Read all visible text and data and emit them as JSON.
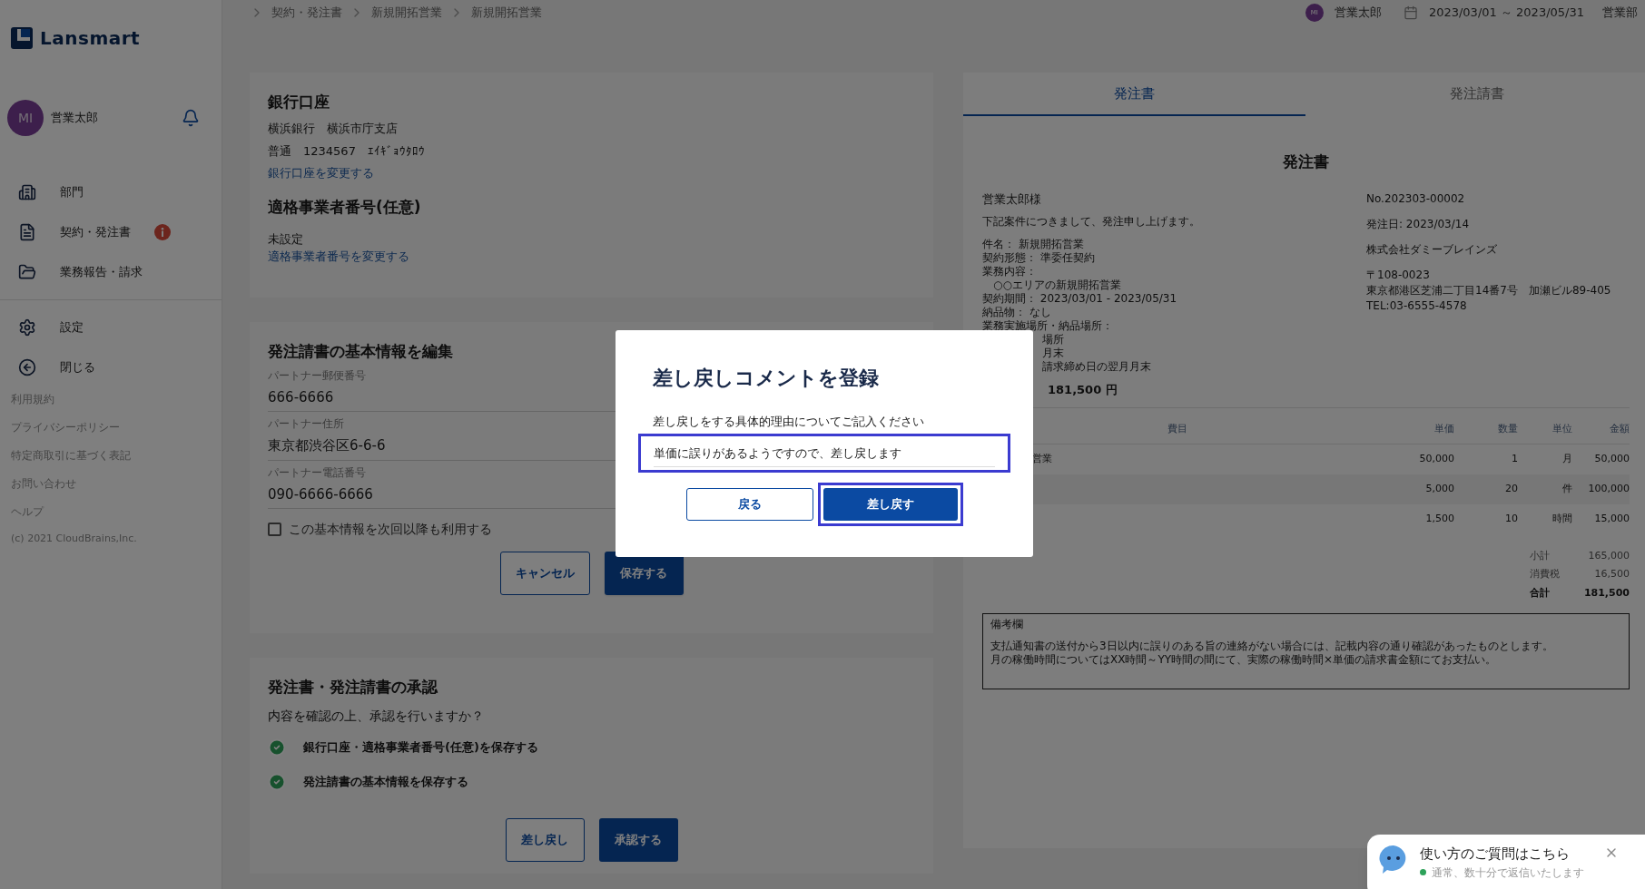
{
  "sidebar": {
    "logo": "Lansmart",
    "user": {
      "initials": "MI",
      "name": "営業太郎"
    },
    "nav": [
      {
        "label": "部門",
        "alert": false
      },
      {
        "label": "契約・発注書",
        "alert": true
      },
      {
        "label": "業務報告・請求",
        "alert": false
      }
    ],
    "nav2": [
      "設定",
      "閉じる"
    ],
    "links": [
      "利用規約",
      "プライバシーポリシー",
      "特定商取引に基づく表記",
      "お問い合わせ",
      "ヘルプ"
    ],
    "copyright": "(c) 2021 CloudBrains,Inc."
  },
  "breadcrumb": [
    "契約・発注書",
    "新規開拓営業",
    "新規開拓営業"
  ],
  "header": {
    "initials": "MI",
    "user": "営業太郎",
    "period": "2023/03/01 ～ 2023/05/31",
    "department": "営業部"
  },
  "bank": {
    "title": "銀行口座",
    "lines": [
      "横浜銀行　横浜市庁支店",
      "普通　1234567　ｴｲｷﾞｮｳﾀﾛｳ"
    ],
    "link": "銀行口座を変更する",
    "title2": "適格事業者番号(任意)",
    "value2": "未設定",
    "link2": "適格事業者番号を変更する"
  },
  "form": {
    "title": "発注請書の基本情報を編集",
    "fields": [
      {
        "label": "パートナー郵便番号",
        "value": "666-6666"
      },
      {
        "label": "パートナー住所",
        "value": "東京都渋谷区6-6-6"
      },
      {
        "label": "パートナー電話番号",
        "value": "090-6666-6666"
      }
    ],
    "checkbox": {
      "label": "この基本情報を次回以降も利用する",
      "checked": false
    },
    "cancel": "キャンセル",
    "save": "保存する"
  },
  "approval": {
    "title": "発注書・発注請書の承認",
    "question": "内容を確認の上、承認を行いますか？",
    "items": [
      {
        "label": "銀行口座・適格事業者番号(任意)を保存する",
        "done": true
      },
      {
        "label": "発注請書の基本情報を保存する",
        "done": true
      }
    ],
    "reject": "差し戻し",
    "approve": "承認する"
  },
  "document": {
    "tabs": [
      {
        "label": "発注書",
        "selected": true
      },
      {
        "label": "発注請書",
        "selected": false
      }
    ],
    "title": "発注書",
    "recipient": "営業太郎様",
    "intro": "下記案件につきまして、発注申し上げます。",
    "details": [
      "件名： 新規開拓営業",
      "契約形態： 準委任契約",
      "業務内容：",
      "　○○エリアの新規開拓営業",
      "契約期間： 2023/03/01 - 2023/05/31",
      "納品物： なし",
      "業務実施場所・納品場所："
    ],
    "details_partial": [
      "場所",
      "月末",
      "請求締め日の翌月月末"
    ],
    "amount": "181,500 円",
    "issuer": [
      "No.202303-00002",
      "発注日: 2023/03/14",
      "株式会社ダミーブレインズ",
      "〒108-0023",
      "東京都港区芝浦二丁目14番7号　加瀬ビル89-405",
      "TEL:03-6555-4578"
    ],
    "columns": [
      "費目",
      "単価",
      "数量",
      "単位",
      "金額"
    ],
    "rows": [
      {
        "item": "営業",
        "price": "50,000",
        "qty": "1",
        "unit": "月",
        "amount": "50,000"
      },
      {
        "price": "5,000",
        "qty": "20",
        "unit": "件",
        "amount": "100,000"
      },
      {
        "price": "1,500",
        "qty": "10",
        "unit": "時間",
        "amount": "15,000"
      }
    ],
    "totals": [
      {
        "label": "小計",
        "value": "165,000",
        "kind": "sub"
      },
      {
        "label": "消費税",
        "value": "16,500",
        "kind": "sub"
      },
      {
        "label": "合計",
        "value": "181,500",
        "kind": "total"
      }
    ],
    "remarks": {
      "title": "備考欄",
      "lines": [
        "支払通知書の送付から3日以内に誤りのある旨の連絡がない場合には、記載内容の通り確認があったものとします。",
        "月の稼働時間についてはXX時間～YY時間の間にて、実際の稼働時間×単価の請求書金額にてお支払い。"
      ]
    }
  },
  "modal": {
    "title": "差し戻しコメントを登録",
    "prompt": "差し戻しをする具体的理由についてご記入ください",
    "value": "単価に誤りがあるようですので、差し戻します",
    "back": "戻る",
    "submit": "差し戻す"
  },
  "chat": {
    "title": "使い方のご質問はこちら",
    "status": "通常、数十分で返信いたします",
    "online": true
  }
}
